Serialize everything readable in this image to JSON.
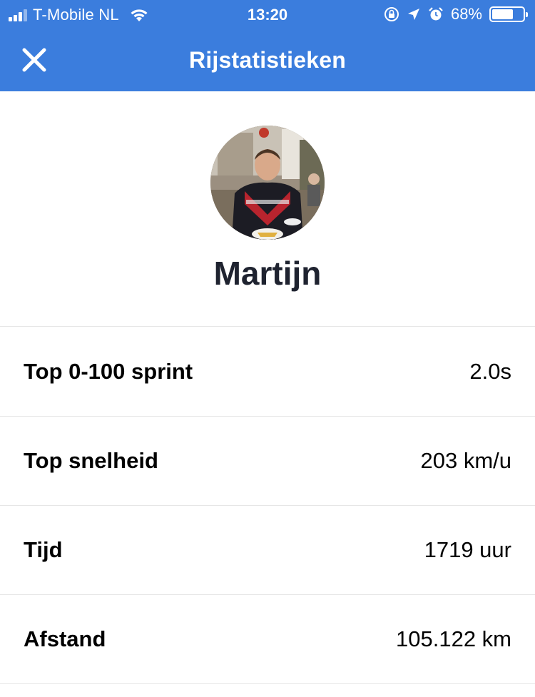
{
  "status_bar": {
    "carrier": "T-Mobile NL",
    "time": "13:20",
    "battery_percent": "68%",
    "battery_level": 0.68,
    "icons": [
      "signal-icon",
      "wifi-icon",
      "rotation-lock-icon",
      "location-icon",
      "alarm-icon",
      "battery-icon"
    ]
  },
  "header": {
    "title": "Rijstatistieken",
    "close_icon": "close-icon"
  },
  "profile": {
    "name": "Martijn"
  },
  "stats": [
    {
      "label": "Top 0-100 sprint",
      "value": "2.0s"
    },
    {
      "label": "Top snelheid",
      "value": "203 km/u"
    },
    {
      "label": "Tijd",
      "value": "1719 uur"
    },
    {
      "label": "Afstand",
      "value": "105.122 km"
    }
  ],
  "colors": {
    "header_bg": "#3b7ddd",
    "name_text": "#1f2330",
    "divider": "#e6e6e6"
  }
}
